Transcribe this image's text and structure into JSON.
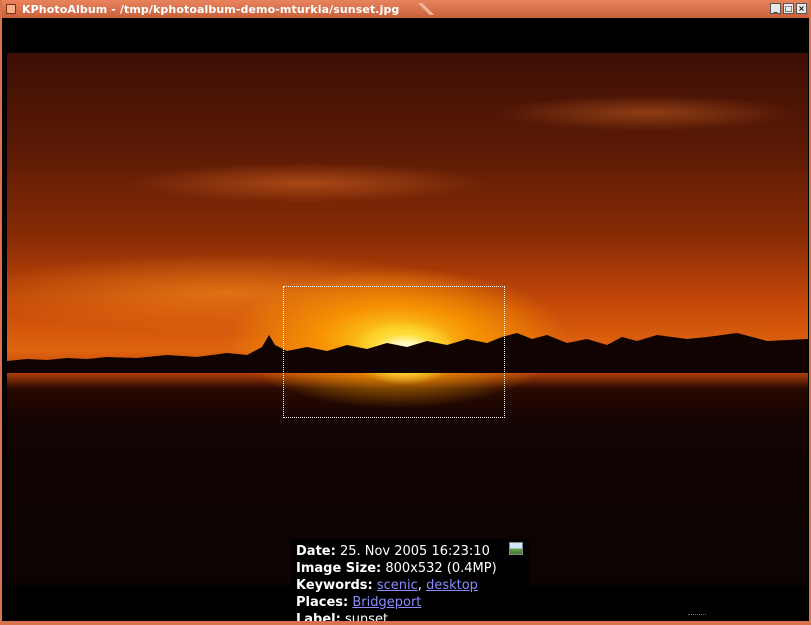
{
  "window": {
    "title": "KPhotoAlbum - /tmp/kphotoalbum-demo-mturkia/sunset.jpg",
    "accent_color": "#d9734e",
    "buttons": [
      {
        "name": "minimize",
        "glyph": "_"
      },
      {
        "name": "maximize",
        "glyph": "□"
      },
      {
        "name": "close",
        "glyph": "×"
      }
    ]
  },
  "info": {
    "date_label": "Date:",
    "date_value": "25. Nov 2005 16:23:10",
    "size_label": "Image Size:",
    "size_value": "800x532 (0.4MP)",
    "keywords_label": "Keywords:",
    "keywords": [
      "scenic",
      "desktop"
    ],
    "keywords_separator": ",",
    "places_label": "Places:",
    "places_value": "Bridgeport",
    "label_label": "Label:",
    "label_value": "sunset",
    "link_color": "#8b8bff"
  }
}
